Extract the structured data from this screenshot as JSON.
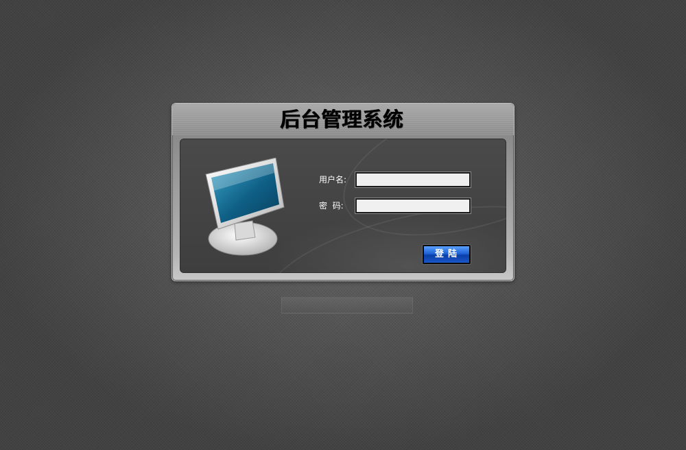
{
  "window": {
    "title": "后台管理系统"
  },
  "login": {
    "username_label": "用户名:",
    "password_label": "密  码:",
    "username_value": "",
    "password_value": "",
    "submit_label": "登陆"
  },
  "icons": {
    "monitor": "computer-monitor-icon"
  },
  "colors": {
    "button_blue": "#1f62d6",
    "panel_dark": "#444444",
    "background": "#5a5a5a"
  }
}
